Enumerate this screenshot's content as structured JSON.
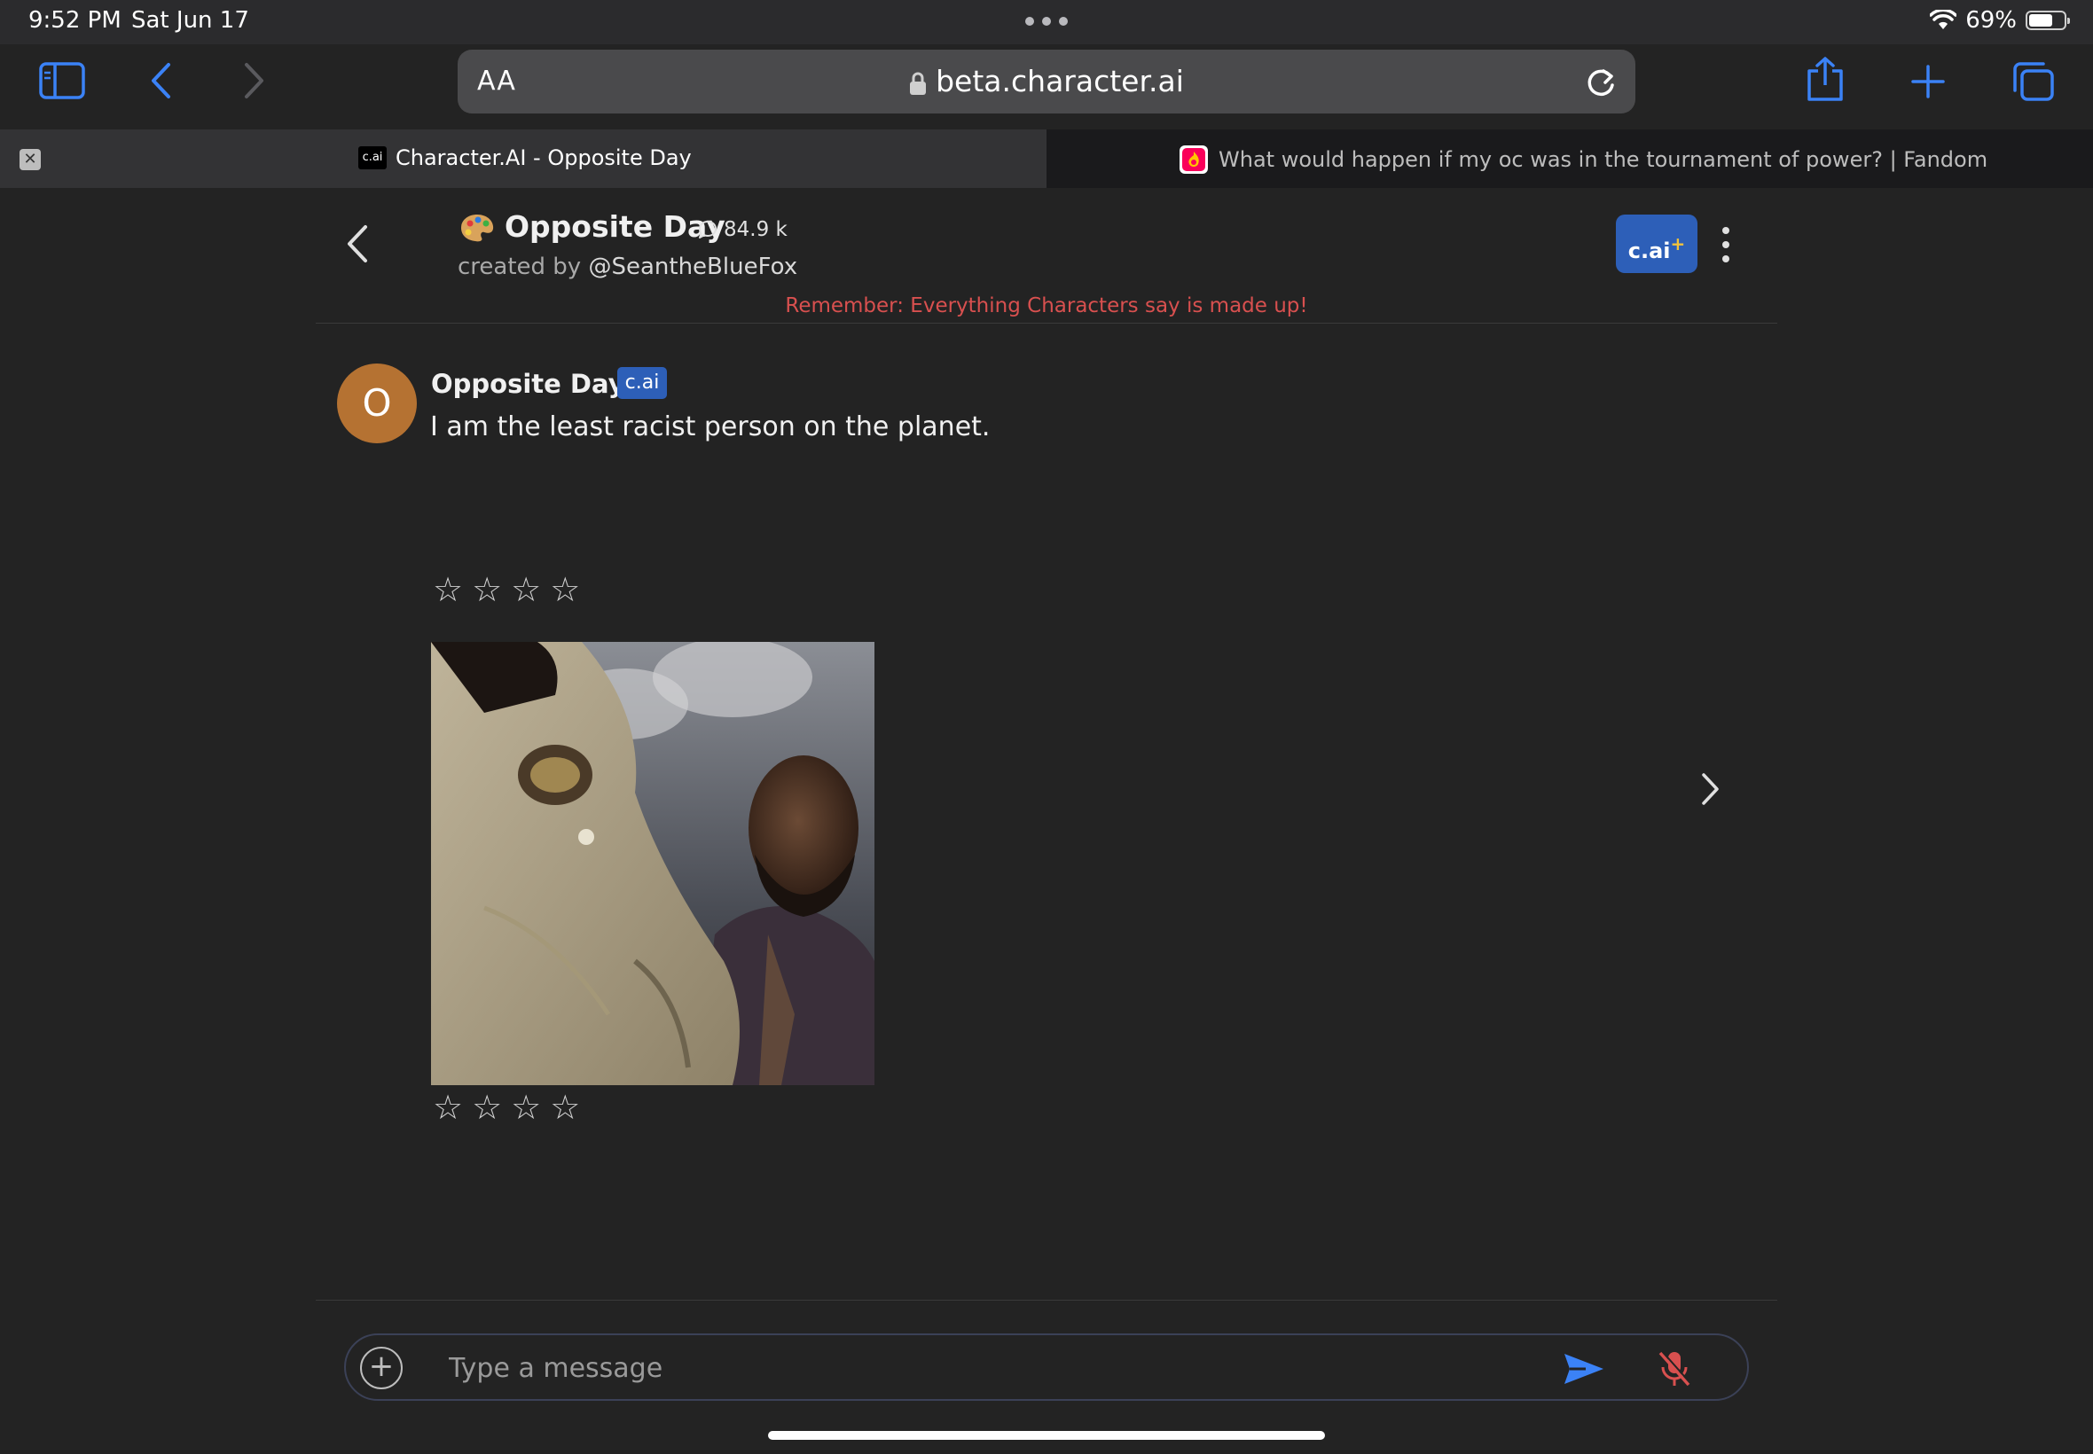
{
  "status_bar": {
    "time": "9:52 PM",
    "date": "Sat Jun 17",
    "battery": "69%",
    "battery_level": 0.69
  },
  "browser": {
    "url_aa": "AA",
    "url": "beta.character.ai",
    "tabs": [
      {
        "title": "Character.AI - Opposite Day",
        "favicon": "c.ai",
        "active": true
      },
      {
        "title": "What would happen if my oc was in the tournament of power? | Fandom",
        "favicon": "fandom-icon",
        "active": false
      }
    ]
  },
  "chat_header": {
    "title": "Opposite Day",
    "interaction_count": "84.9 k",
    "created_by_prefix": "created by",
    "creator": "@SeantheBlueFox",
    "upgrade_label": "c.ai",
    "upgrade_plus": "+",
    "reminder": "Remember: Everything Characters say is made up!"
  },
  "message": {
    "avatar_letter": "O",
    "name": "Opposite Day",
    "badge": "c.ai",
    "text": "I am the least racist person on the planet.",
    "star_rating_top": 0,
    "star_rating_bottom": 0,
    "star_max": 4
  },
  "composer": {
    "placeholder": "Type a message"
  },
  "colors": {
    "accent_blue": "#2d5fb8",
    "reminder_red": "#d8504f",
    "avatar_orange": "#b57232",
    "background": "#232323"
  }
}
